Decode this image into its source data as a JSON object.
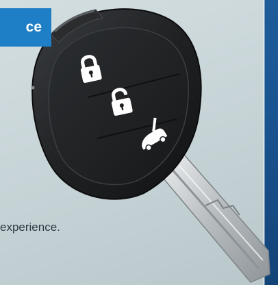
{
  "badge": {
    "text": "ce"
  },
  "body": {
    "text": "experience."
  },
  "key_fob": {
    "buttons": [
      {
        "icon": "lock-icon"
      },
      {
        "icon": "unlock-icon"
      },
      {
        "icon": "trunk-icon"
      }
    ],
    "colors": {
      "fob": "#1d1f21",
      "blade": "#c9ccce",
      "accent": "#1f7fc6"
    }
  }
}
